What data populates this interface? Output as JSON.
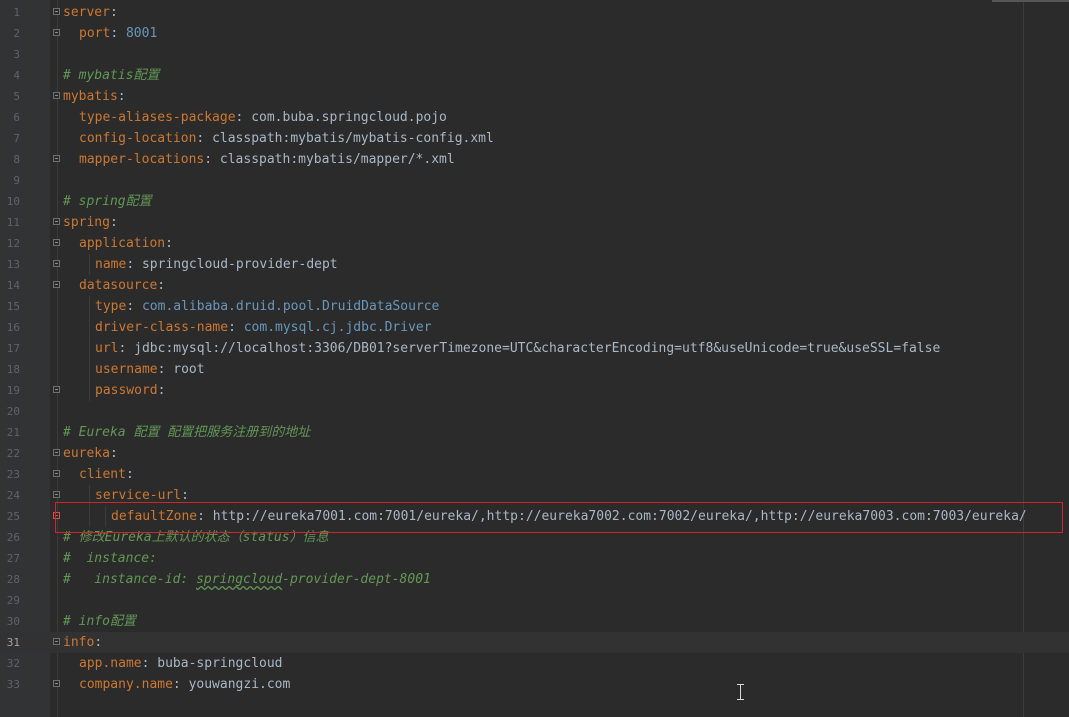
{
  "editor": {
    "language": "yaml",
    "current_line": 31,
    "colors": {
      "background": "#2b2b2b",
      "key": "#cc7832",
      "value": "#a9b7c6",
      "number": "#6897bb",
      "comment": "#629755",
      "line_number": "#606366",
      "highlight_box": "#d0242d"
    },
    "lines": [
      {
        "n": "1",
        "fold": true,
        "indent": 0,
        "key": "server",
        "colon": ":",
        "value": "",
        "vtype": "",
        "comment": ""
      },
      {
        "n": "2",
        "fold": true,
        "indent": 1,
        "key": "port",
        "colon": ": ",
        "value": "8001",
        "vtype": "n",
        "comment": ""
      },
      {
        "n": "3",
        "fold": false,
        "indent": 0,
        "key": "",
        "colon": "",
        "value": "",
        "vtype": "",
        "comment": ""
      },
      {
        "n": "4",
        "fold": false,
        "indent": 0,
        "key": "",
        "colon": "",
        "value": "",
        "vtype": "",
        "comment": "# mybatis配置"
      },
      {
        "n": "5",
        "fold": true,
        "indent": 0,
        "key": "mybatis",
        "colon": ":",
        "value": "",
        "vtype": "",
        "comment": ""
      },
      {
        "n": "6",
        "fold": false,
        "indent": 1,
        "key": "type-aliases-package",
        "colon": ": ",
        "value": "com.buba.springcloud.pojo",
        "vtype": "v",
        "comment": ""
      },
      {
        "n": "7",
        "fold": false,
        "indent": 1,
        "key": "config-location",
        "colon": ": ",
        "value": "classpath:mybatis/mybatis-config.xml",
        "vtype": "v",
        "comment": ""
      },
      {
        "n": "8",
        "fold": true,
        "indent": 1,
        "key": "mapper-locations",
        "colon": ": ",
        "value": "classpath:mybatis/mapper/*.xml",
        "vtype": "v",
        "comment": ""
      },
      {
        "n": "9",
        "fold": false,
        "indent": 0,
        "key": "",
        "colon": "",
        "value": "",
        "vtype": "",
        "comment": ""
      },
      {
        "n": "10",
        "fold": false,
        "indent": 0,
        "key": "",
        "colon": "",
        "value": "",
        "vtype": "",
        "comment": "# spring配置"
      },
      {
        "n": "11",
        "fold": true,
        "indent": 0,
        "key": "spring",
        "colon": ":",
        "value": "",
        "vtype": "",
        "comment": ""
      },
      {
        "n": "12",
        "fold": true,
        "indent": 1,
        "key": "application",
        "colon": ":",
        "value": "",
        "vtype": "",
        "comment": ""
      },
      {
        "n": "13",
        "fold": true,
        "indent": 2,
        "key": "name",
        "colon": ": ",
        "value": "springcloud-provider-dept",
        "vtype": "v",
        "comment": ""
      },
      {
        "n": "14",
        "fold": true,
        "indent": 1,
        "key": "datasource",
        "colon": ":",
        "value": "",
        "vtype": "",
        "comment": ""
      },
      {
        "n": "15",
        "fold": false,
        "indent": 2,
        "key": "type",
        "colon": ": ",
        "value": "com.alibaba.druid.pool.DruidDataSource",
        "vtype": "n",
        "comment": ""
      },
      {
        "n": "16",
        "fold": false,
        "indent": 2,
        "key": "driver-class-name",
        "colon": ": ",
        "value": "com.mysql.cj.jdbc.Driver",
        "vtype": "n",
        "comment": ""
      },
      {
        "n": "17",
        "fold": false,
        "indent": 2,
        "key": "url",
        "colon": ": ",
        "value": "jdbc:mysql://localhost:3306/DB01?serverTimezone=UTC&characterEncoding=utf8&useUnicode=true&useSSL=false",
        "vtype": "v",
        "comment": ""
      },
      {
        "n": "18",
        "fold": false,
        "indent": 2,
        "key": "username",
        "colon": ": ",
        "value": "root",
        "vtype": "v",
        "comment": ""
      },
      {
        "n": "19",
        "fold": true,
        "indent": 2,
        "key": "password",
        "colon": ":",
        "value": "",
        "vtype": "",
        "comment": ""
      },
      {
        "n": "20",
        "fold": false,
        "indent": 0,
        "key": "",
        "colon": "",
        "value": "",
        "vtype": "",
        "comment": ""
      },
      {
        "n": "21",
        "fold": false,
        "indent": 0,
        "key": "",
        "colon": "",
        "value": "",
        "vtype": "",
        "comment": "# Eureka 配置 配置把服务注册到的地址"
      },
      {
        "n": "22",
        "fold": true,
        "indent": 0,
        "key": "eureka",
        "colon": ":",
        "value": "",
        "vtype": "",
        "comment": ""
      },
      {
        "n": "23",
        "fold": true,
        "indent": 1,
        "key": "client",
        "colon": ":",
        "value": "",
        "vtype": "",
        "comment": ""
      },
      {
        "n": "24",
        "fold": true,
        "indent": 2,
        "key": "service-url",
        "colon": ":",
        "value": "",
        "vtype": "",
        "comment": ""
      },
      {
        "n": "25",
        "fold": true,
        "fold_red": true,
        "indent": 3,
        "key": "defaultZone",
        "colon": ": ",
        "value": "http://eureka7001.com:7001/eureka/,http://eureka7002.com:7002/eureka/,http://eureka7003.com:7003/eureka/",
        "vtype": "v",
        "comment": ""
      },
      {
        "n": "26",
        "fold": false,
        "indent": 0,
        "key": "",
        "colon": "",
        "value": "",
        "vtype": "",
        "comment": "# 修改Eureka上默认的状态（status）信息"
      },
      {
        "n": "27",
        "fold": false,
        "indent": 0,
        "key": "",
        "colon": "",
        "value": "",
        "vtype": "",
        "comment": "#  instance:"
      },
      {
        "n": "28",
        "fold": false,
        "indent": 0,
        "key": "",
        "colon": "",
        "value": "",
        "vtype": "",
        "comment": "#   instance-id: ",
        "comment_underlined": "springcloud",
        "comment_tail": "-provider-dept-8001"
      },
      {
        "n": "29",
        "fold": false,
        "indent": 0,
        "key": "",
        "colon": "",
        "value": "",
        "vtype": "",
        "comment": ""
      },
      {
        "n": "30",
        "fold": false,
        "indent": 0,
        "key": "",
        "colon": "",
        "value": "",
        "vtype": "",
        "comment": "# info配置"
      },
      {
        "n": "31",
        "fold": true,
        "indent": 0,
        "key": "info",
        "colon": ":",
        "value": "",
        "vtype": "",
        "comment": ""
      },
      {
        "n": "32",
        "fold": false,
        "indent": 1,
        "key": "app.name",
        "colon": ": ",
        "value": "buba-springcloud",
        "vtype": "v",
        "comment": ""
      },
      {
        "n": "33",
        "fold": true,
        "indent": 1,
        "key": "company.name",
        "colon": ": ",
        "value": "youwangzi.com",
        "vtype": "v",
        "comment": ""
      }
    ]
  }
}
